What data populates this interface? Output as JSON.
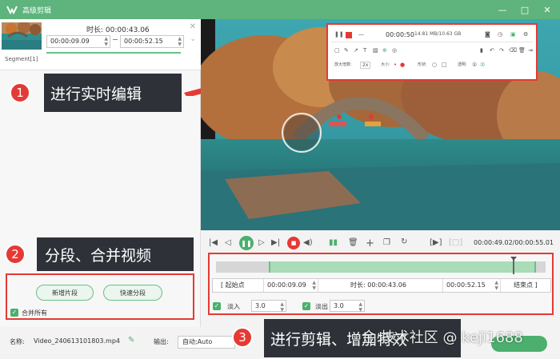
{
  "window": {
    "title": "高级剪辑",
    "controls": [
      "—",
      "□",
      "✕"
    ]
  },
  "clip": {
    "duration_label": "时长:",
    "duration_value": "00:00:43.06",
    "start_time": "00:00:09.09",
    "end_time": "00:00:52.15",
    "segment_label": "Segment[1]"
  },
  "annotations": [
    {
      "number": "1",
      "text": "进行实时编辑"
    },
    {
      "number": "2",
      "text": "分段、合并视频"
    },
    {
      "number": "3",
      "text": "进行剪辑、增加特效"
    }
  ],
  "segment_panel": {
    "new_segment_button": "新增片段",
    "quick_split_button": "快速分段",
    "merge_all_label": "合并所有",
    "merge_all_checked": true
  },
  "screenshot_toolbar": {
    "time": "00:00:50",
    "size": "14.81 MB/10.63 GB",
    "speed_label": "放大倍数:",
    "speed_value": "2x",
    "size_label": "大小:",
    "shape_label": "形状:",
    "opacity_label": "透明:"
  },
  "player": {
    "timecode": "00:00:49.02/00:00:55.01"
  },
  "editor": {
    "track_fill_start": 0.16,
    "track_fill_end": 0.97,
    "playhead": 0.9,
    "start_point_label": "起始点",
    "start_point_value": "00:00:09.09",
    "duration_label": "时长:",
    "duration_value": "00:00:43.06",
    "end_point_value": "00:00:52.15",
    "end_point_label": "结束点",
    "fade_in_label": "淡入",
    "fade_in_value": "3.0",
    "fade_in_checked": true,
    "fade_out_label": "淡出",
    "fade_out_value": "3.0",
    "fade_out_checked": true
  },
  "footer": {
    "name_label": "名称:",
    "file_name": "Video_240613101803.mp4",
    "output_label": "输出:",
    "output_value": "自动;Auto"
  },
  "watermark": "金 技术社区 @ keji1688",
  "colors": {
    "accent": "#5eb47c",
    "highlight": "#e53935",
    "annotation_bg": "#2e3238"
  }
}
